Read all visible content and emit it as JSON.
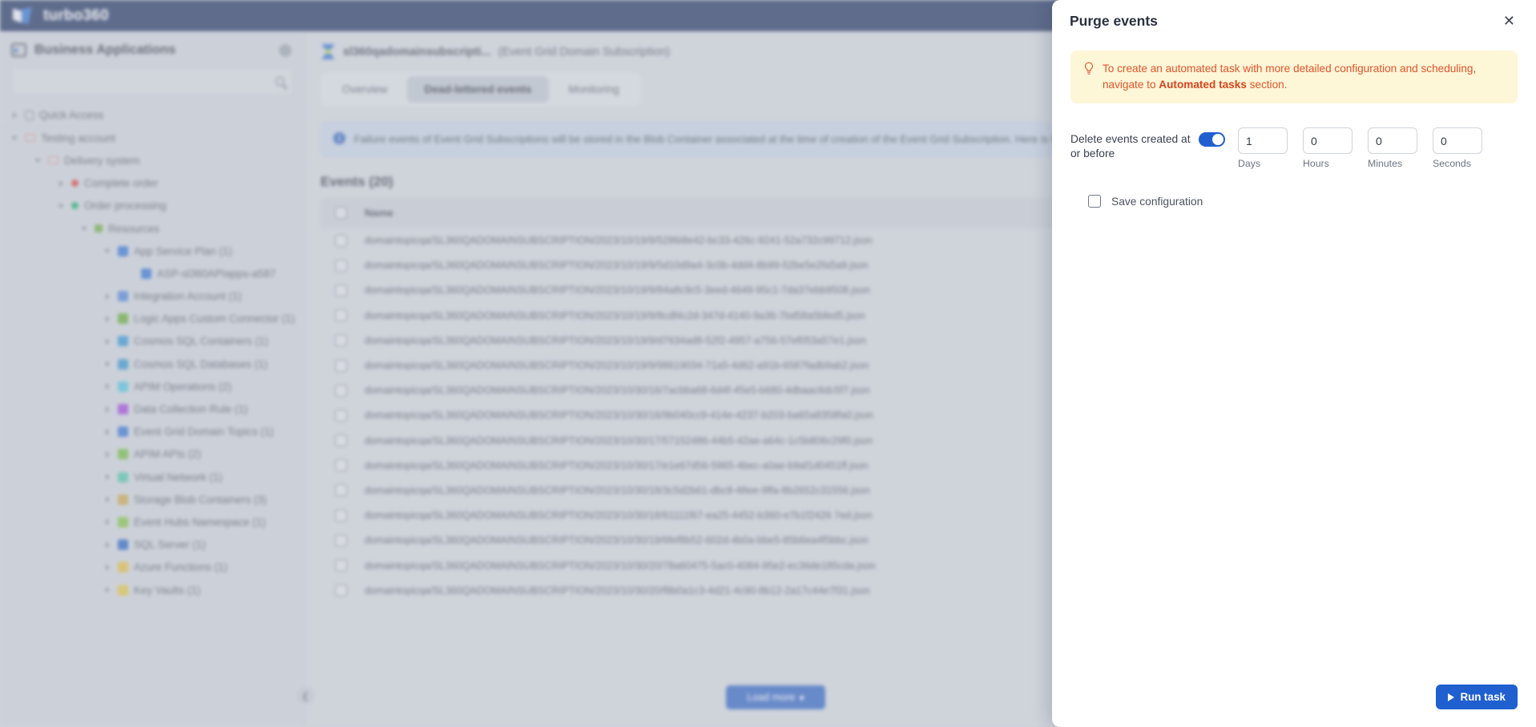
{
  "topbar": {
    "brand": "turbo360",
    "logo_icon": "turbo-logo-icon"
  },
  "sidebar": {
    "title": "Business Applications",
    "title_icon": "business-applications-icon",
    "settings_icon": "gear-icon",
    "search": {
      "value": "",
      "placeholder": "",
      "icon": "search-icon"
    },
    "items": [
      {
        "label": "Quick Access",
        "indent": 0,
        "caret": "right",
        "icon": "bookmark-icon",
        "icon_type": "bk",
        "color": "#6c7482",
        "divider": true
      },
      {
        "label": "Testing account",
        "indent": 0,
        "caret": "down",
        "icon": "folder-icon",
        "icon_type": "folder",
        "color": "#e07b7b"
      },
      {
        "label": "Delivery system",
        "indent": 1,
        "caret": "down",
        "icon": "folder-icon",
        "icon_type": "folder",
        "color": "#e07b7b"
      },
      {
        "label": "Complete order",
        "indent": 2,
        "caret": "right",
        "icon": "status-dot-red-icon",
        "icon_type": "dot",
        "color": "#d93a3a"
      },
      {
        "label": "Order processing",
        "indent": 2,
        "caret": "down",
        "icon": "status-dot-green-icon",
        "icon_type": "dot",
        "color": "#14a86a"
      },
      {
        "label": "Resources",
        "indent": 3,
        "caret": "down",
        "icon": "resources-icon",
        "icon_type": "sq",
        "color": "#6ba83f"
      },
      {
        "label": "App Service Plan (1)",
        "indent": 4,
        "caret": "down",
        "icon": "app-service-plan-icon",
        "icon_type": "ri",
        "color": "#2f6fd0"
      },
      {
        "label": "ASP-sl360APIapps-a587",
        "indent": 5,
        "caret": "none",
        "icon": "app-service-plan-icon",
        "icon_type": "ri",
        "color": "#2f6fd0"
      },
      {
        "label": "Integration Account (1)",
        "indent": 4,
        "caret": "right",
        "icon": "integration-account-icon",
        "icon_type": "ri",
        "color": "#4a7fd6"
      },
      {
        "label": "Logic Apps Custom Connector (1)",
        "indent": 4,
        "caret": "right",
        "icon": "logic-apps-connector-icon",
        "icon_type": "ri",
        "color": "#5fa832"
      },
      {
        "label": "Cosmos SQL Containers (1)",
        "indent": 4,
        "caret": "right",
        "icon": "cosmos-sql-container-icon",
        "icon_type": "ri",
        "color": "#2f8fd0"
      },
      {
        "label": "Cosmos SQL Databases (1)",
        "indent": 4,
        "caret": "right",
        "icon": "cosmos-sql-database-icon",
        "icon_type": "ri",
        "color": "#2f8fd0"
      },
      {
        "label": "APIM Operations (2)",
        "indent": 4,
        "caret": "right",
        "icon": "apim-operations-icon",
        "icon_type": "ri",
        "color": "#4fc0d8"
      },
      {
        "label": "Data Collection Rule (1)",
        "indent": 4,
        "caret": "right",
        "icon": "data-collection-rule-icon",
        "icon_type": "ri",
        "color": "#9b3fd8"
      },
      {
        "label": "Event Grid Domain Topics (1)",
        "indent": 4,
        "caret": "right",
        "icon": "event-grid-domain-topics-icon",
        "icon_type": "ri",
        "color": "#2f6fd0"
      },
      {
        "label": "APIM APIs (2)",
        "indent": 4,
        "caret": "right",
        "icon": "apim-apis-icon",
        "icon_type": "ri",
        "color": "#6db83f"
      },
      {
        "label": "Virtual Network (1)",
        "indent": 4,
        "caret": "right",
        "icon": "virtual-network-icon",
        "icon_type": "ri",
        "color": "#4fc0a8"
      },
      {
        "label": "Storage Blob Containers (3)",
        "indent": 4,
        "caret": "right",
        "icon": "storage-blob-containers-icon",
        "icon_type": "ri",
        "color": "#c8a24a"
      },
      {
        "label": "Event Hubs Namespace (1)",
        "indent": 4,
        "caret": "right",
        "icon": "event-hubs-namespace-icon",
        "icon_type": "ri",
        "color": "#7fbf3f"
      },
      {
        "label": "SQL Server (1)",
        "indent": 4,
        "caret": "right",
        "icon": "sql-server-icon",
        "icon_type": "ri",
        "color": "#1f5fc0"
      },
      {
        "label": "Azure Functions (1)",
        "indent": 4,
        "caret": "right",
        "icon": "azure-functions-icon",
        "icon_type": "ri",
        "color": "#e0b83a"
      },
      {
        "label": "Key Vaults (1)",
        "indent": 4,
        "caret": "right",
        "icon": "key-vaults-icon",
        "icon_type": "ri",
        "color": "#e0c23a"
      }
    ]
  },
  "main": {
    "resource_icon": "event-grid-subscription-icon",
    "resource_name": "sl360qadomainsubscripti...",
    "resource_type": "(Event Grid Domain Subscription)",
    "tabs": [
      {
        "label": "Overview",
        "active": false
      },
      {
        "label": "Dead-lettered events",
        "active": true
      },
      {
        "label": "Monitoring",
        "active": false
      }
    ],
    "info_icon": "info-icon",
    "info_text": "Failure events of Event Grid Subscriptions will be stored in the Blob Container associated at the time of creation of the Event Grid Subscription. Here is the blobs list generated due to failure events.",
    "events_title": "Events (20)",
    "select_all_checkbox": "select-all",
    "column_header": "Name",
    "rows": [
      "domaintopicqa/SL360QADOMAINSUBSCRIPTION/2023/10/19/9/5286i8e42-bc33-426c-9241-52a732c99712.json",
      "domaintopicqa/SL360QADOMAINSUBSCRIPTION/2023/10/19/9/5d10d9a4-3c0b-4dd4-8b99-52be5e2fa5a9.json",
      "domaintopicqa/SL360QADOMAINSUBSCRIPTION/2023/10/19/9/84a8c9c5-3eed-4649-95c1-7da37ebb9508.json",
      "domaintopicqa/SL360QADOMAINSUBSCRIPTION/2023/10/19/9/8cdf4c2d-347d-4140-9a36-7bd58a5bfed5.json",
      "domaintopicqa/SL360QADOMAINSUBSCRIPTION/2023/10/19/9/d7634ad8-52f2-4957-a756-57ef053a57e1.json",
      "domaintopicqa/SL360QADOMAINSUBSCRIPTION/2023/10/19/9/98619034-71a5-4d62-a91b-6587fadb9ab2.json",
      "domaintopicqa/SL360QADOMAINSUBSCRIPTION/2023/10/30/16/7acbba68-6d4f-45e5-b680-4dbaac6dc5f7.json",
      "domaintopicqa/SL360QADOMAINSUBSCRIPTION/2023/10/30/16/9b040cc9-414e-4237-b203-ba65a8358fa0.json",
      "domaintopicqa/SL360QADOMAINSUBSCRIPTION/2023/10/30/17/57152486-44b5-42ae-a64c-1c5b806c29f0.json",
      "domaintopicqa/SL360QADOMAINSUBSCRIPTION/2023/10/30/17/e1e67d56-5965-4bec-a0ae-b9af1d0451ff.json",
      "domaintopicqa/SL360QADOMAINSUBSCRIPTION/2023/10/30/18/3c5d2b61-dbc8-48ee-9ffa-8b2652c31556.json",
      "domaintopicqa/SL360QADOMAINSUBSCRIPTION/2023/10/30/18/61111f67-ea25-4452-b360-e7b1f2426 7ed.json",
      "domaintopicqa/SL360QADOMAINSUBSCRIPTION/2023/10/30/19/6fef8b52-602d-4b0a-bbe5-85b6ea4f5bbc.json",
      "domaintopicqa/SL360QADOMAINSUBSCRIPTION/2023/10/30/20/78a60475-5ac0-4084-95e2-ec36de185cda.json",
      "domaintopicqa/SL360QADOMAINSUBSCRIPTION/2023/10/30/20/f8b0a1c3-4d21-4c90-8b12-2a17c44e7f31.json"
    ],
    "load_more": {
      "label": "Load more",
      "caret_icon": "chevron-down-icon"
    },
    "collapse_icon": "collapse-sidebar-icon"
  },
  "panel": {
    "title": "Purge events",
    "close_icon": "close-icon",
    "tip": {
      "icon": "lightbulb-icon",
      "text_before": "To create an automated task with more detailed configuration and scheduling, navigate to ",
      "link": "Automated tasks",
      "text_after": " section."
    },
    "delete_label": "Delete events created at or before",
    "toggle": {
      "name": "delete-events-toggle",
      "on": true
    },
    "fields": [
      {
        "name": "days-input",
        "value": "1",
        "label": "Days"
      },
      {
        "name": "hours-input",
        "value": "0",
        "label": "Hours"
      },
      {
        "name": "minutes-input",
        "value": "0",
        "label": "Minutes"
      },
      {
        "name": "seconds-input",
        "value": "0",
        "label": "Seconds"
      }
    ],
    "save_configuration": {
      "label": "Save configuration",
      "checked": false
    },
    "run_task": {
      "label": "Run task",
      "icon": "play-icon"
    }
  },
  "colors": {
    "brand_navy": "#1c2f5e",
    "accent_blue": "#1f5fd0",
    "tip_bg": "#fdf6d7",
    "tip_text": "#e2542a",
    "info_bg": "#c3cfe1"
  }
}
